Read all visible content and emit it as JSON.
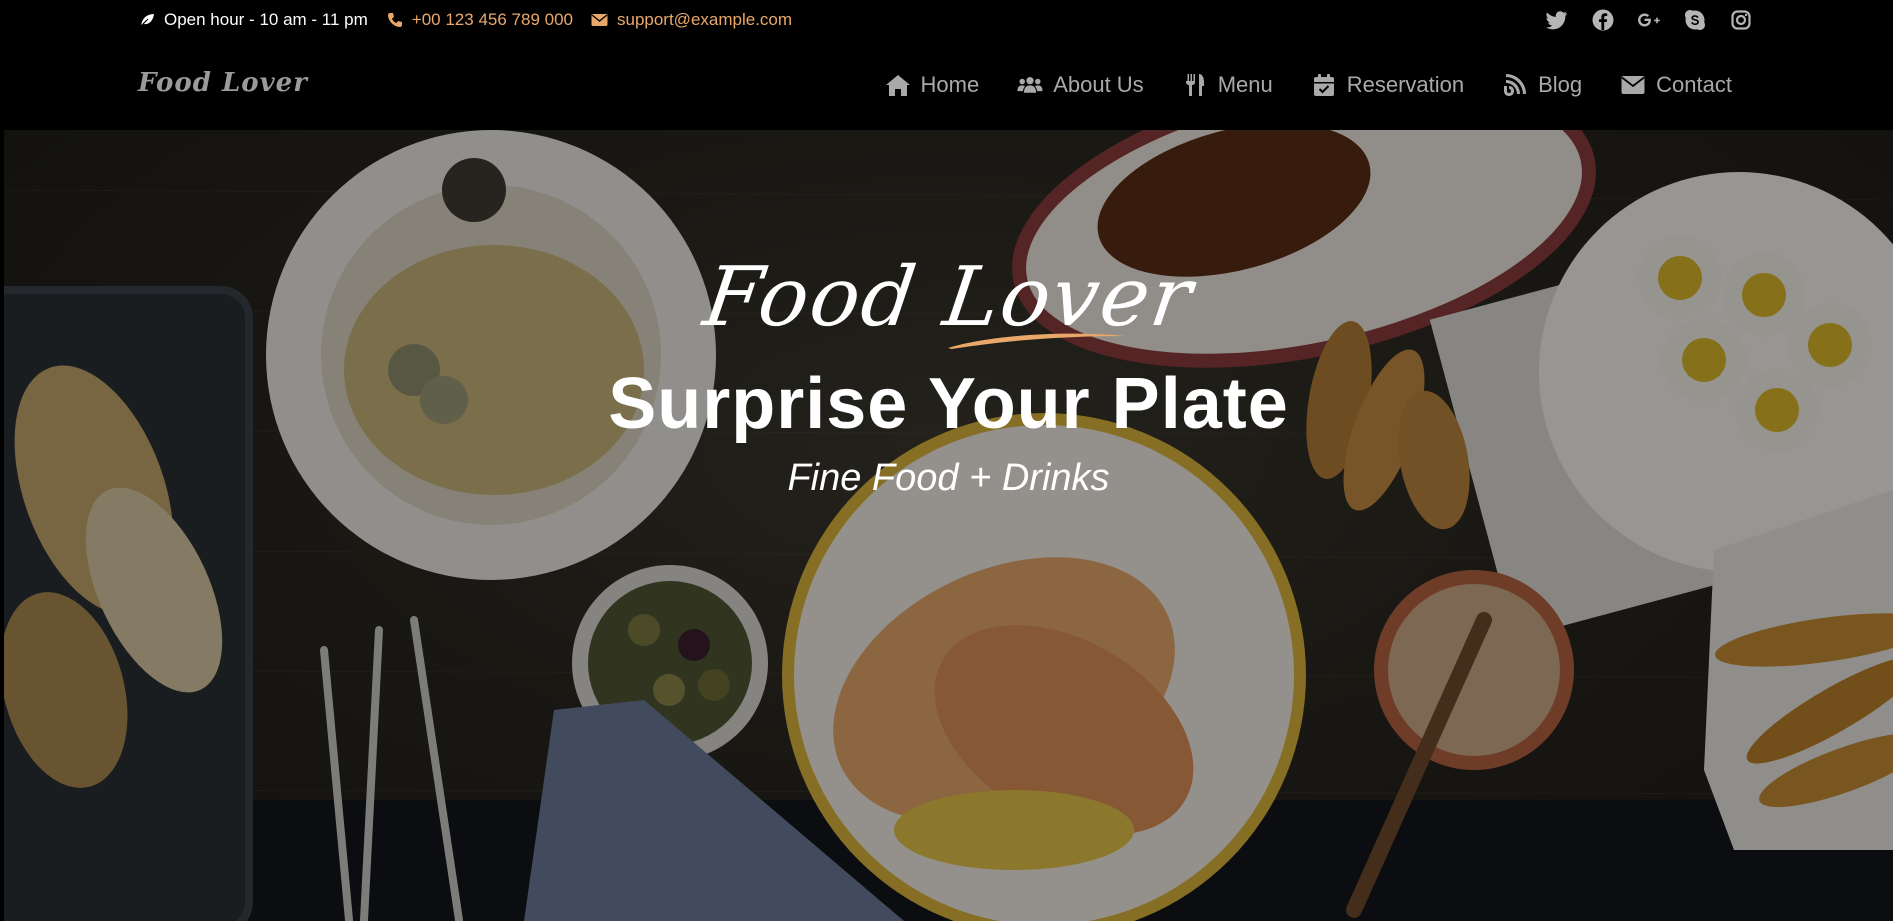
{
  "topbar": {
    "hours": "Open hour - 10 am - 11 pm",
    "phone": "+00 123 456 789 000",
    "email": "support@example.com",
    "icons": {
      "hours": "leaf-icon",
      "phone": "phone-icon",
      "email": "envelope-icon"
    },
    "social": [
      "twitter-icon",
      "facebook-icon",
      "google-plus-icon",
      "skype-icon",
      "instagram-icon"
    ]
  },
  "navbar": {
    "brand": "Food Lover",
    "items": [
      {
        "label": "Home",
        "icon": "home-icon"
      },
      {
        "label": "About Us",
        "icon": "users-icon"
      },
      {
        "label": "Menu",
        "icon": "utensils-icon"
      },
      {
        "label": "Reservation",
        "icon": "calendar-icon"
      },
      {
        "label": "Blog",
        "icon": "blog-icon"
      },
      {
        "label": "Contact",
        "icon": "envelope-icon"
      }
    ]
  },
  "hero": {
    "logo": "Food Lover",
    "title": "Surprise Your Plate",
    "subtitle": "Fine Food + Drinks"
  },
  "colors": {
    "accent": "#e9a86a",
    "nav_text": "#a9a9a9",
    "background": "#000000",
    "hero_text": "#ffffff"
  }
}
